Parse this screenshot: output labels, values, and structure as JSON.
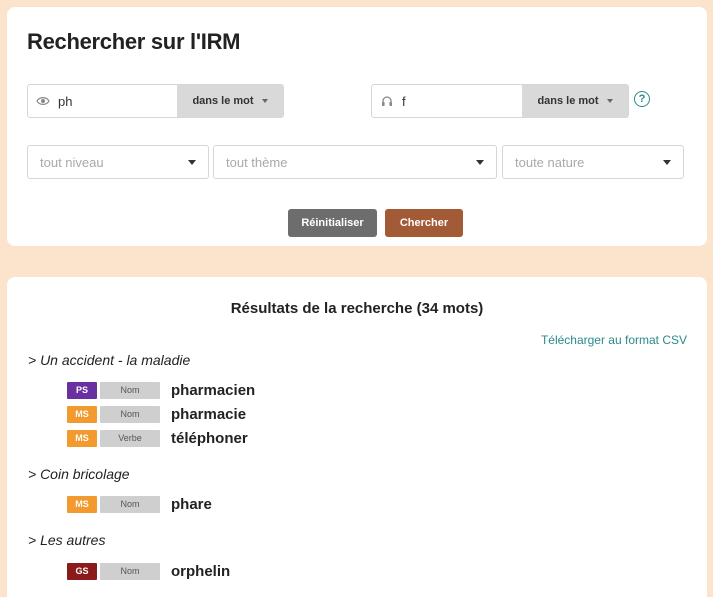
{
  "search": {
    "title": "Rechercher sur l'IRM",
    "field_a": {
      "value": "ph",
      "icon": "eye-icon",
      "mode": "dans le mot"
    },
    "field_b": {
      "value": "f",
      "icon": "headphones-icon",
      "mode": "dans le mot"
    },
    "help": "?",
    "filters": {
      "niveau": "tout niveau",
      "theme": "tout thème",
      "nature": "toute nature"
    },
    "reset_label": "Réinitialiser",
    "search_label": "Chercher"
  },
  "results": {
    "title": "Résultats de la recherche (34 mots)",
    "csv_label": "Télécharger au format CSV",
    "groups": [
      {
        "heading": "> Un accident - la maladie",
        "items": [
          {
            "level": "PS",
            "level_color": "#6a2fa0",
            "category": "Nom",
            "word": "pharmacien"
          },
          {
            "level": "MS",
            "level_color": "#f39a2e",
            "category": "Nom",
            "word": "pharmacie"
          },
          {
            "level": "MS",
            "level_color": "#f39a2e",
            "category": "Verbe",
            "word": "téléphoner"
          }
        ]
      },
      {
        "heading": "> Coin bricolage",
        "items": [
          {
            "level": "MS",
            "level_color": "#f39a2e",
            "category": "Nom",
            "word": "phare"
          }
        ]
      },
      {
        "heading": "> Les autres",
        "items": [
          {
            "level": "GS",
            "level_color": "#8b1a1a",
            "category": "Nom",
            "word": "orphelin"
          }
        ]
      }
    ]
  }
}
